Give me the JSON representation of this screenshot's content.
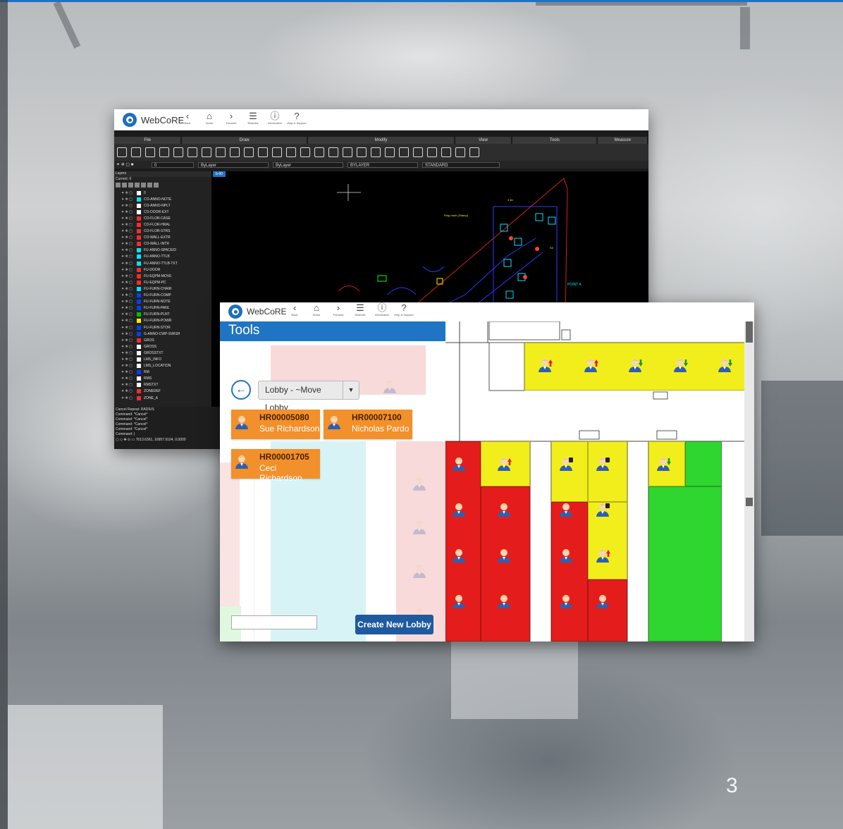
{
  "page_number": "3",
  "colors": {
    "accent": "#1f74c4",
    "orange": "#f2902b",
    "red": "#e51c1c",
    "yellow": "#f2ee1c",
    "green": "#2fd62f"
  },
  "cad": {
    "logo": "WebCoRE",
    "nav": [
      {
        "icon": "chevron-left-icon",
        "glyph": "‹",
        "label": "Back"
      },
      {
        "icon": "home-icon",
        "glyph": "⌂",
        "label": "Home"
      },
      {
        "icon": "chevron-right-icon",
        "glyph": "›",
        "label": "Forward"
      },
      {
        "icon": "menu-icon",
        "glyph": "☰",
        "label": "Modules"
      },
      {
        "icon": "info-icon",
        "glyph": "ⓘ",
        "label": "Information"
      },
      {
        "icon": "help-icon",
        "glyph": "?",
        "label": "Help & Support"
      }
    ],
    "ribbon_groups": [
      "File",
      "Draw",
      "Modify",
      "View",
      "Tools",
      "Measure"
    ],
    "props": {
      "layer": "0",
      "color": "ByLayer",
      "linetype": "ByLayer",
      "lineweight": "BYLAYER",
      "style": "STANDARD"
    },
    "layers_panel": {
      "title": "Layers",
      "current": "Current: 0",
      "items": [
        "0",
        "CO-ANNO-NOTE",
        "CO-ANNO-NPLT",
        "CO-DOOR-EXT",
        "CO-FLOR-CASE",
        "CO-FLOR-HRAL",
        "CO-FLOR-STRS",
        "CO-WALL-EXTR",
        "CO-WALL-INTR",
        "FU-ANNO-SPACEID",
        "FU-ANNO-TTLB",
        "FU-ANNO-TTLB-TXT",
        "FU-DOOR",
        "FU-EQPM-MOVE",
        "FU-EQPM-PC",
        "FU-FURN-CHAIR",
        "FU-FURN-COMP",
        "FU-FURN-NOTE",
        "FU-FURN-PANL",
        "FU-FURN-PLNT",
        "FU-FURN-POWR",
        "FU-FURN-STOR",
        "G-ANNO-CWP-SWISH",
        "GROS",
        "GROSS",
        "GROSSTXT",
        "LMS_INFO",
        "LMS_LOCATION",
        "RM",
        "RMS",
        "RMSTXT",
        "ZONEDEF",
        "ZONE_A"
      ],
      "swatches": [
        "#ffffff",
        "#00e5ff",
        "#ffffff",
        "#ffffff",
        "#ff2b2b",
        "#ff2b2b",
        "#ff2b2b",
        "#ff2b2b",
        "#ff2b2b",
        "#00e5ff",
        "#00e5ff",
        "#00e5ff",
        "#ff2b2b",
        "#ff2b2b",
        "#ff2b2b",
        "#00e5ff",
        "#0040ff",
        "#0040ff",
        "#0040ff",
        "#00c000",
        "#ffee00",
        "#0040ff",
        "#0040ff",
        "#ff2b2b",
        "#ffffff",
        "#ffffff",
        "#ffffff",
        "#ffffff",
        "#0040ff",
        "#ffffff",
        "#ffffff",
        "#ff2b2b",
        "#ff2b2b"
      ]
    },
    "drawing_tab": "b-00",
    "command_lines": [
      "Cancel  Repeat: RADIUS",
      "Command: *Cancel*",
      "Command: *Cancel*",
      "Command: *Cancel*",
      "Command: *Cancel*",
      "Command: |"
    ],
    "coords": "7613.6361, 16957.9104, 0.0000",
    "drawing_labels": [
      "POINT A"
    ]
  },
  "tools": {
    "logo": "WebCoRE",
    "title": "Tools",
    "lobby_select": "Lobby - ~Move Lobby",
    "employees": [
      {
        "code": "HR00005080",
        "name": "Sue Richardson"
      },
      {
        "code": "HR00007100",
        "name": "Nicholas Pardo"
      },
      {
        "code": "HR00001705",
        "name": "Ceci Richardson"
      }
    ],
    "create_button": "Create New Lobby"
  }
}
